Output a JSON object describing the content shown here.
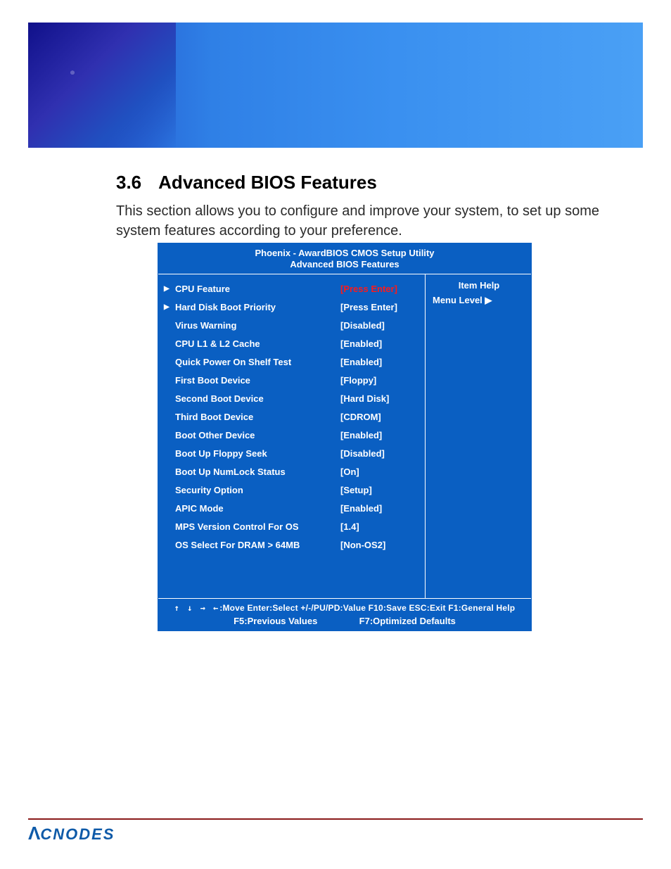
{
  "section": {
    "number": "3.6",
    "title": "Advanced BIOS Features",
    "description": "This section allows you to configure and improve your system, to set up some system features according to your preference."
  },
  "bios": {
    "header_line1": "Phoenix - AwardBIOS CMOS Setup Utility",
    "header_line2": "Advanced BIOS Features",
    "help_title": "Item Help",
    "menu_level_label": "Menu Level",
    "menu_level_arrow": "▶",
    "rows": [
      {
        "marker": "▶",
        "label": "CPU Feature",
        "value": "[Press Enter]",
        "value_style": "red"
      },
      {
        "marker": "▶",
        "label": "Hard Disk Boot Priority",
        "value": "[Press Enter]",
        "value_style": ""
      },
      {
        "marker": "",
        "label": "Virus Warning",
        "value": "[Disabled]",
        "value_style": ""
      },
      {
        "marker": "",
        "label": "CPU L1 & L2 Cache",
        "value": "[Enabled]",
        "value_style": ""
      },
      {
        "marker": "",
        "label": "Quick Power On Shelf Test",
        "value": "[Enabled]",
        "value_style": ""
      },
      {
        "marker": "",
        "label": "First Boot Device",
        "value": "[Floppy]",
        "value_style": ""
      },
      {
        "marker": "",
        "label": "Second Boot Device",
        "value": "[Hard Disk]",
        "value_style": ""
      },
      {
        "marker": "",
        "label": "Third Boot Device",
        "value": "[CDROM]",
        "value_style": ""
      },
      {
        "marker": "",
        "label": "Boot Other Device",
        "value": "[Enabled]",
        "value_style": ""
      },
      {
        "marker": "",
        "label": "Boot Up Floppy Seek",
        "value": "[Disabled]",
        "value_style": ""
      },
      {
        "marker": "",
        "label": "Boot Up NumLock Status",
        "value": "[On]",
        "value_style": ""
      },
      {
        "marker": "",
        "label": "Security Option",
        "value": "[Setup]",
        "value_style": ""
      },
      {
        "marker": "",
        "label": "APIC Mode",
        "value": "[Enabled]",
        "value_style": ""
      },
      {
        "marker": "",
        "label": "MPS Version Control For OS",
        "value": "[1.4]",
        "value_style": ""
      },
      {
        "marker": "",
        "label": "OS Select For DRAM > 64MB",
        "value": "[Non-OS2]",
        "value_style": ""
      }
    ],
    "footer": {
      "arrows": "↑ ↓ → ←",
      "line1_rest": ":Move  Enter:Select  +/-/PU/PD:Value  F10:Save  ESC:Exit  F1:General Help",
      "f5": "F5:Previous Values",
      "f7": "F7:Optimized Defaults"
    }
  },
  "brand": {
    "text": "CNODES",
    "lambda": "Λ"
  }
}
